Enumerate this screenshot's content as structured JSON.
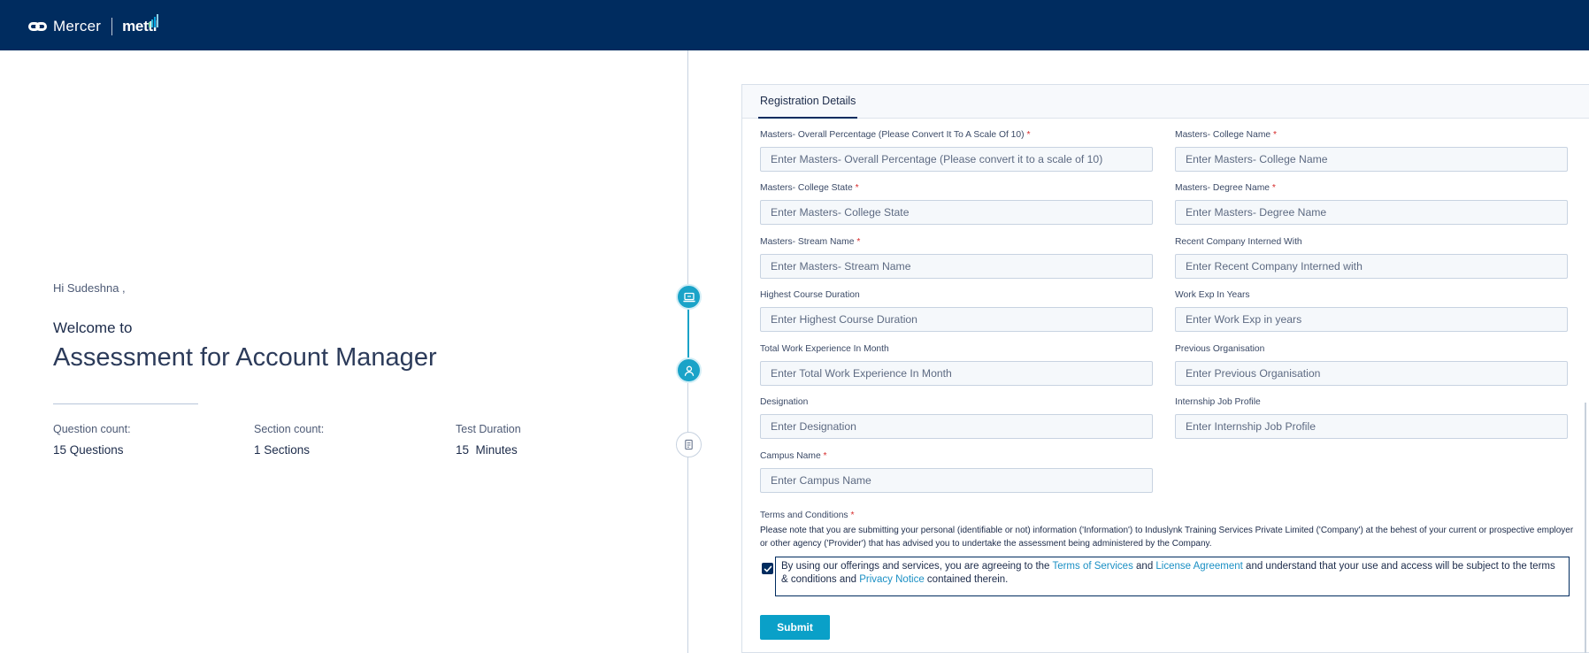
{
  "header": {
    "brand_name": "Mercer",
    "product_name": "mettl"
  },
  "welcome": {
    "greeting": "Hi Sudeshna ,",
    "welcome_to": "Welcome to",
    "assessment_title": "Assessment for Account Manager",
    "stats": [
      {
        "label": "Question count:",
        "value": "15 Questions"
      },
      {
        "label": "Section count:",
        "value": "1 Sections"
      },
      {
        "label": "Test Duration",
        "value": "15  Minutes"
      }
    ]
  },
  "stepper": {
    "steps": [
      {
        "icon": "laptop-icon",
        "state": "completed"
      },
      {
        "icon": "user-icon",
        "state": "active"
      },
      {
        "icon": "document-icon",
        "state": "pending"
      }
    ]
  },
  "form": {
    "tab_label": "Registration Details",
    "fields": [
      {
        "label": "Masters- Overall Percentage (Please Convert It To A Scale Of 10)",
        "required": "*",
        "placeholder": "Enter Masters- Overall Percentage (Please convert it to a scale of 10)"
      },
      {
        "label": "Masters- College Name",
        "required": "*",
        "placeholder": "Enter Masters- College Name"
      },
      {
        "label": "Masters- College State",
        "required": "*",
        "placeholder": "Enter Masters- College State"
      },
      {
        "label": "Masters- Degree Name",
        "required": "*",
        "placeholder": "Enter Masters- Degree Name"
      },
      {
        "label": "Masters- Stream Name",
        "required": "*",
        "placeholder": "Enter Masters- Stream Name"
      },
      {
        "label": "Recent Company Interned With",
        "required": "",
        "placeholder": "Enter Recent Company Interned with"
      },
      {
        "label": "Highest Course Duration",
        "required": "",
        "placeholder": "Enter Highest Course Duration"
      },
      {
        "label": "Work Exp In Years",
        "required": "",
        "placeholder": "Enter Work Exp in years"
      },
      {
        "label": "Total Work Experience In Month",
        "required": "",
        "placeholder": "Enter Total Work Experience In Month"
      },
      {
        "label": "Previous Organisation",
        "required": "",
        "placeholder": "Enter Previous Organisation"
      },
      {
        "label": "Designation",
        "required": "",
        "placeholder": "Enter Designation"
      },
      {
        "label": "Internship Job Profile",
        "required": "",
        "placeholder": "Enter Internship Job Profile"
      },
      {
        "label": "Campus Name",
        "required": "*",
        "placeholder": "Enter Campus Name"
      }
    ],
    "terms": {
      "title": "Terms and Conditions",
      "required": "*",
      "text": "Please note that you are submitting your personal (identifiable or not) information ('Information') to Induslynk Training Services Private Limited ('Company') at the behest of your current or prospective employer or other agency ('Provider') that has advised you to undertake the assessment being administered by the Company."
    },
    "agreement": {
      "checked": true,
      "text_1": "By using our offerings and services, you are agreeing to the ",
      "link_terms": "Terms of Services",
      "text_2": " and ",
      "link_license": "License Agreement",
      "text_3": " and understand that your use and access will be subject to the terms & conditions and ",
      "link_privacy": "Privacy Notice",
      "text_4": " contained therein."
    },
    "submit_label": "Submit"
  },
  "colors": {
    "header_bg": "#002c5f",
    "accent": "#1aa3c8",
    "link": "#1a8fc4",
    "required": "#d62b2b"
  }
}
